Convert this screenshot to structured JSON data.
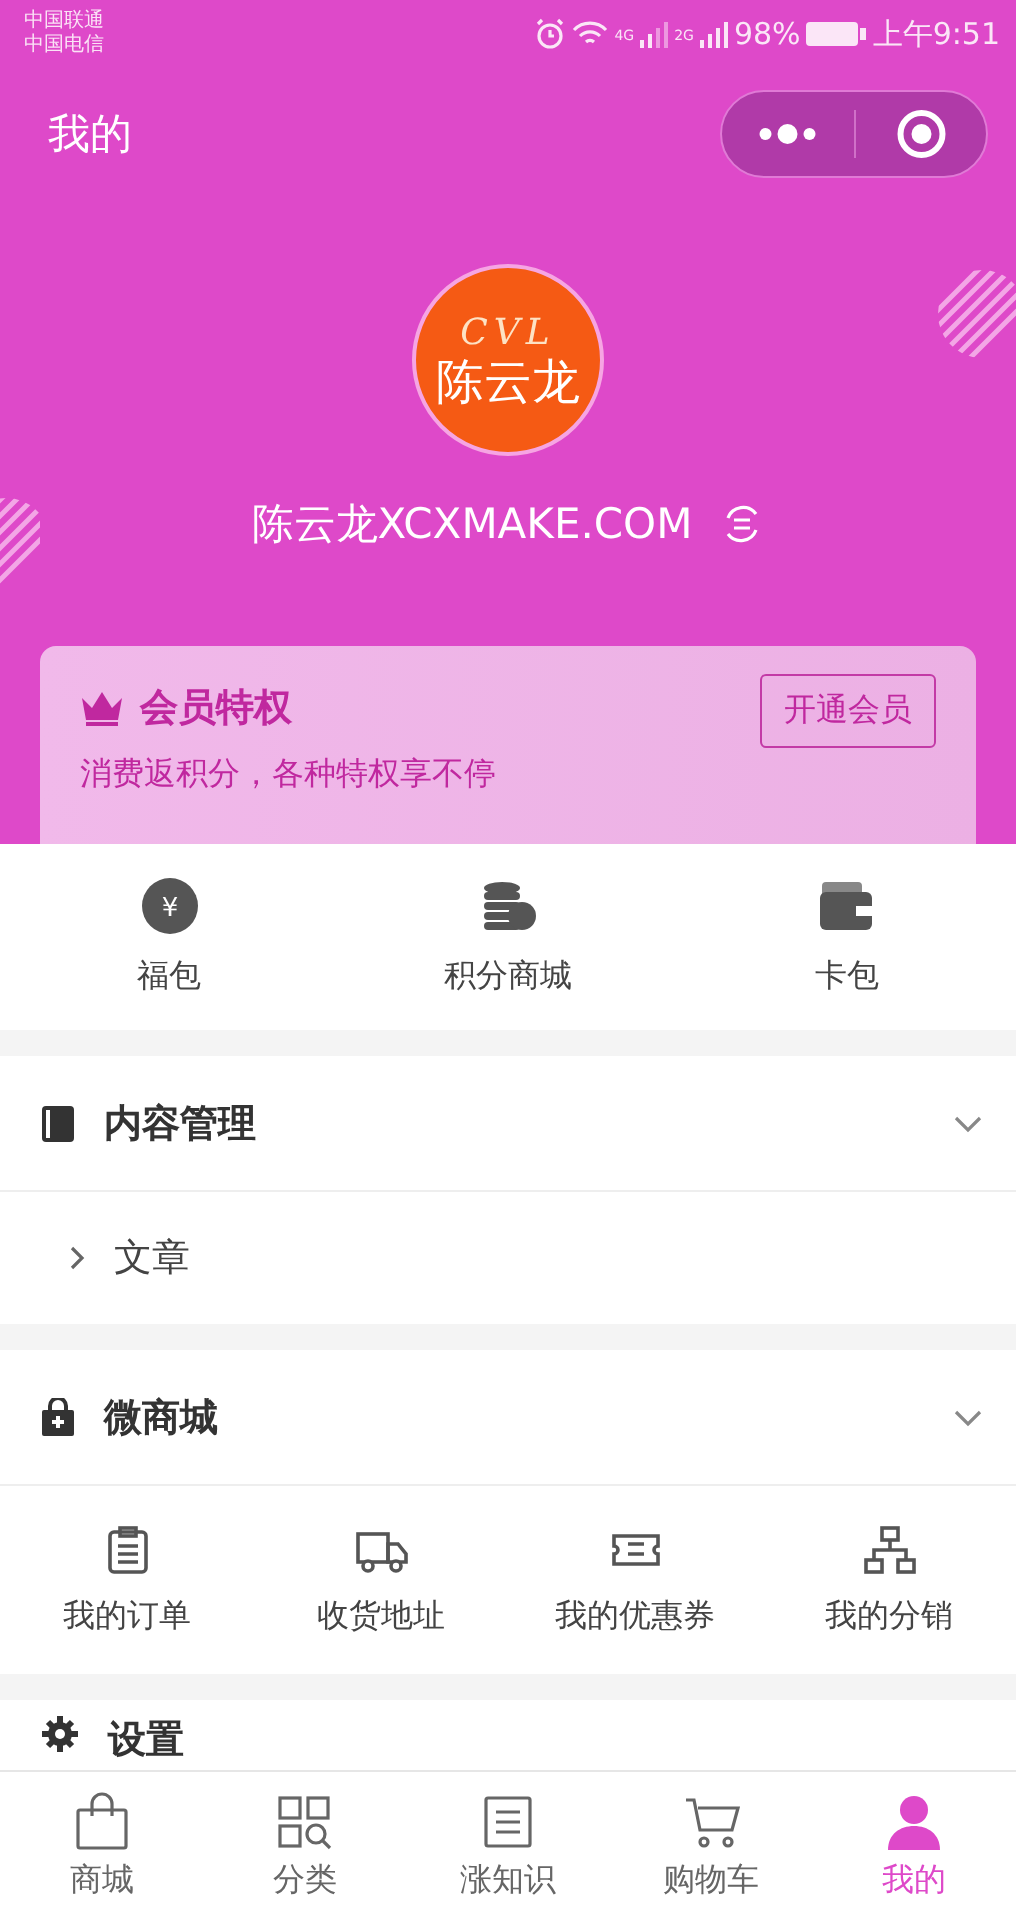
{
  "status_bar": {
    "carriers": [
      "中国联通",
      "中国电信"
    ],
    "network_1": "4G",
    "network_2": "2G",
    "battery": "98%",
    "time": "上午9:51"
  },
  "nav": {
    "title": "我的"
  },
  "profile": {
    "avatar_top": "CVL",
    "avatar_name": "陈云龙",
    "name": "陈云龙XCXMAKE.COM"
  },
  "membership": {
    "title": "会员特权",
    "subtitle": "消费返积分，各种特权享不停",
    "button": "开通会员"
  },
  "quick_links": [
    {
      "kind": "pouch",
      "label": "福包",
      "glyph": "¥"
    },
    {
      "kind": "coins",
      "label": "积分商城"
    },
    {
      "kind": "wallet",
      "label": "卡包"
    }
  ],
  "sections": [
    {
      "kind": "book",
      "title": "内容管理",
      "expanded": true,
      "items": [
        {
          "label": "文章"
        }
      ]
    },
    {
      "kind": "shop",
      "title": "微商城",
      "expanded": true,
      "grid": [
        {
          "kind": "order",
          "label": "我的订单"
        },
        {
          "kind": "truck",
          "label": "收货地址"
        },
        {
          "kind": "coupon",
          "label": "我的优惠券"
        },
        {
          "kind": "tree",
          "label": "我的分销"
        }
      ]
    },
    {
      "kind": "gear",
      "title": "设置"
    }
  ],
  "tab_bar": [
    {
      "kind": "bag",
      "label": "商城",
      "selected": false
    },
    {
      "kind": "grid",
      "label": "分类",
      "selected": false
    },
    {
      "kind": "note",
      "label": "涨知识",
      "selected": false
    },
    {
      "kind": "cart",
      "label": "购物车",
      "selected": false
    },
    {
      "kind": "person",
      "label": "我的",
      "selected": true
    }
  ]
}
